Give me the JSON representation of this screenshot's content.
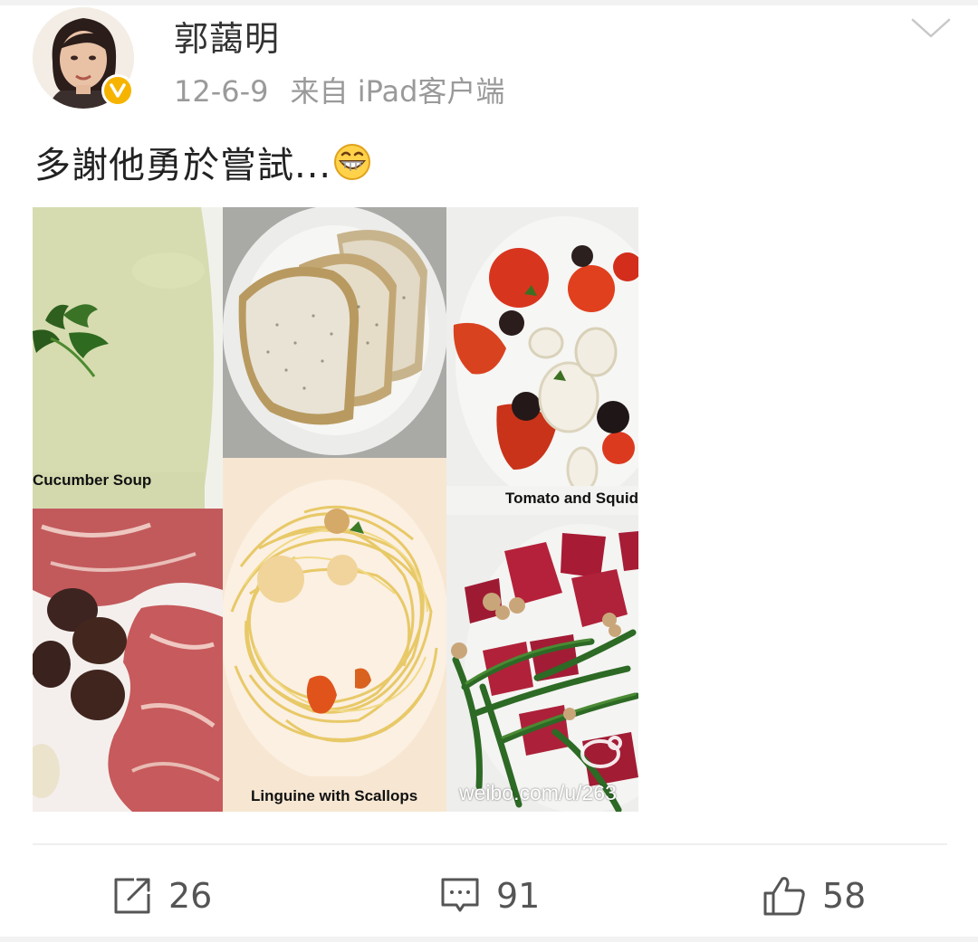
{
  "post": {
    "username": "郭藹明",
    "time": "12-6-9",
    "source": "来自 iPad客户端",
    "text": "多謝他勇於嘗試...",
    "emoji": "grin-emoji"
  },
  "photo_collage": {
    "captions": {
      "soup": "Cucumber Soup",
      "salad": "Tomato and Squid",
      "pasta": "Linguine with Scallops"
    },
    "watermark": "weibo.com/u/263"
  },
  "actions": {
    "repost_count": "26",
    "comment_count": "91",
    "like_count": "58"
  },
  "colors": {
    "verified_badge": "#f6b400",
    "meta_text": "#9a9a9a"
  }
}
